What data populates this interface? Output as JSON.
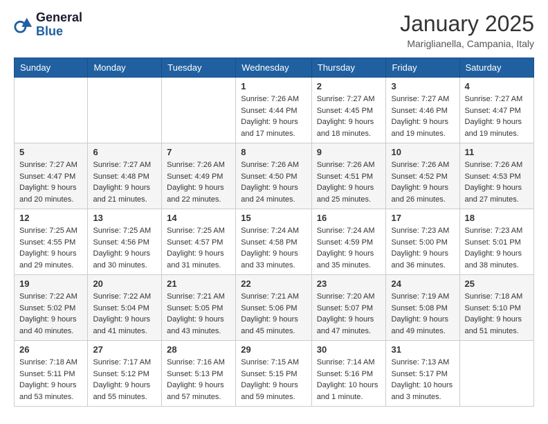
{
  "header": {
    "logo_line1": "General",
    "logo_line2": "Blue",
    "month_title": "January 2025",
    "location": "Mariglianella, Campania, Italy"
  },
  "days_of_week": [
    "Sunday",
    "Monday",
    "Tuesday",
    "Wednesday",
    "Thursday",
    "Friday",
    "Saturday"
  ],
  "weeks": [
    [
      {
        "day": "",
        "info": ""
      },
      {
        "day": "",
        "info": ""
      },
      {
        "day": "",
        "info": ""
      },
      {
        "day": "1",
        "info": "Sunrise: 7:26 AM\nSunset: 4:44 PM\nDaylight: 9 hours\nand 17 minutes."
      },
      {
        "day": "2",
        "info": "Sunrise: 7:27 AM\nSunset: 4:45 PM\nDaylight: 9 hours\nand 18 minutes."
      },
      {
        "day": "3",
        "info": "Sunrise: 7:27 AM\nSunset: 4:46 PM\nDaylight: 9 hours\nand 19 minutes."
      },
      {
        "day": "4",
        "info": "Sunrise: 7:27 AM\nSunset: 4:47 PM\nDaylight: 9 hours\nand 19 minutes."
      }
    ],
    [
      {
        "day": "5",
        "info": "Sunrise: 7:27 AM\nSunset: 4:47 PM\nDaylight: 9 hours\nand 20 minutes."
      },
      {
        "day": "6",
        "info": "Sunrise: 7:27 AM\nSunset: 4:48 PM\nDaylight: 9 hours\nand 21 minutes."
      },
      {
        "day": "7",
        "info": "Sunrise: 7:26 AM\nSunset: 4:49 PM\nDaylight: 9 hours\nand 22 minutes."
      },
      {
        "day": "8",
        "info": "Sunrise: 7:26 AM\nSunset: 4:50 PM\nDaylight: 9 hours\nand 24 minutes."
      },
      {
        "day": "9",
        "info": "Sunrise: 7:26 AM\nSunset: 4:51 PM\nDaylight: 9 hours\nand 25 minutes."
      },
      {
        "day": "10",
        "info": "Sunrise: 7:26 AM\nSunset: 4:52 PM\nDaylight: 9 hours\nand 26 minutes."
      },
      {
        "day": "11",
        "info": "Sunrise: 7:26 AM\nSunset: 4:53 PM\nDaylight: 9 hours\nand 27 minutes."
      }
    ],
    [
      {
        "day": "12",
        "info": "Sunrise: 7:25 AM\nSunset: 4:55 PM\nDaylight: 9 hours\nand 29 minutes."
      },
      {
        "day": "13",
        "info": "Sunrise: 7:25 AM\nSunset: 4:56 PM\nDaylight: 9 hours\nand 30 minutes."
      },
      {
        "day": "14",
        "info": "Sunrise: 7:25 AM\nSunset: 4:57 PM\nDaylight: 9 hours\nand 31 minutes."
      },
      {
        "day": "15",
        "info": "Sunrise: 7:24 AM\nSunset: 4:58 PM\nDaylight: 9 hours\nand 33 minutes."
      },
      {
        "day": "16",
        "info": "Sunrise: 7:24 AM\nSunset: 4:59 PM\nDaylight: 9 hours\nand 35 minutes."
      },
      {
        "day": "17",
        "info": "Sunrise: 7:23 AM\nSunset: 5:00 PM\nDaylight: 9 hours\nand 36 minutes."
      },
      {
        "day": "18",
        "info": "Sunrise: 7:23 AM\nSunset: 5:01 PM\nDaylight: 9 hours\nand 38 minutes."
      }
    ],
    [
      {
        "day": "19",
        "info": "Sunrise: 7:22 AM\nSunset: 5:02 PM\nDaylight: 9 hours\nand 40 minutes."
      },
      {
        "day": "20",
        "info": "Sunrise: 7:22 AM\nSunset: 5:04 PM\nDaylight: 9 hours\nand 41 minutes."
      },
      {
        "day": "21",
        "info": "Sunrise: 7:21 AM\nSunset: 5:05 PM\nDaylight: 9 hours\nand 43 minutes."
      },
      {
        "day": "22",
        "info": "Sunrise: 7:21 AM\nSunset: 5:06 PM\nDaylight: 9 hours\nand 45 minutes."
      },
      {
        "day": "23",
        "info": "Sunrise: 7:20 AM\nSunset: 5:07 PM\nDaylight: 9 hours\nand 47 minutes."
      },
      {
        "day": "24",
        "info": "Sunrise: 7:19 AM\nSunset: 5:08 PM\nDaylight: 9 hours\nand 49 minutes."
      },
      {
        "day": "25",
        "info": "Sunrise: 7:18 AM\nSunset: 5:10 PM\nDaylight: 9 hours\nand 51 minutes."
      }
    ],
    [
      {
        "day": "26",
        "info": "Sunrise: 7:18 AM\nSunset: 5:11 PM\nDaylight: 9 hours\nand 53 minutes."
      },
      {
        "day": "27",
        "info": "Sunrise: 7:17 AM\nSunset: 5:12 PM\nDaylight: 9 hours\nand 55 minutes."
      },
      {
        "day": "28",
        "info": "Sunrise: 7:16 AM\nSunset: 5:13 PM\nDaylight: 9 hours\nand 57 minutes."
      },
      {
        "day": "29",
        "info": "Sunrise: 7:15 AM\nSunset: 5:15 PM\nDaylight: 9 hours\nand 59 minutes."
      },
      {
        "day": "30",
        "info": "Sunrise: 7:14 AM\nSunset: 5:16 PM\nDaylight: 10 hours\nand 1 minute."
      },
      {
        "day": "31",
        "info": "Sunrise: 7:13 AM\nSunset: 5:17 PM\nDaylight: 10 hours\nand 3 minutes."
      },
      {
        "day": "",
        "info": ""
      }
    ]
  ]
}
